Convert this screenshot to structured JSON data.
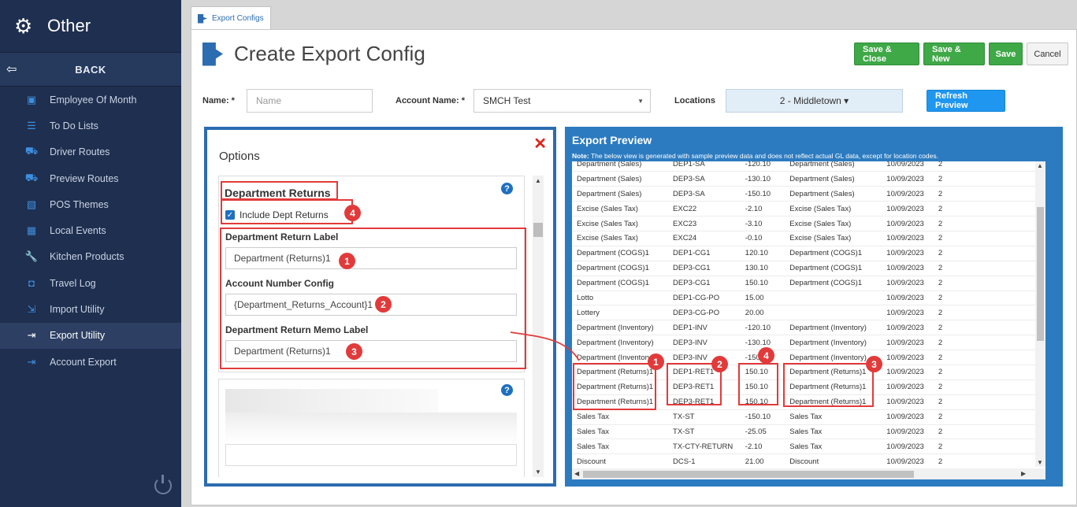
{
  "sidebar": {
    "title": "Other",
    "back_label": "BACK",
    "items": [
      {
        "label": "Employee Of Month",
        "icon": "gift-icon"
      },
      {
        "label": "To Do Lists",
        "icon": "list-icon"
      },
      {
        "label": "Driver Routes",
        "icon": "truck-icon"
      },
      {
        "label": "Preview Routes",
        "icon": "truck-icon"
      },
      {
        "label": "POS Themes",
        "icon": "image-icon"
      },
      {
        "label": "Local Events",
        "icon": "calendar-icon"
      },
      {
        "label": "Kitchen Products",
        "icon": "wrench-icon"
      },
      {
        "label": "Travel Log",
        "icon": "bus-icon"
      },
      {
        "label": "Import Utility",
        "icon": "import-icon"
      },
      {
        "label": "Export Utility",
        "icon": "export-icon",
        "active": true
      },
      {
        "label": "Account Export",
        "icon": "export-icon"
      }
    ]
  },
  "tab": {
    "label": "Export Configs"
  },
  "page": {
    "title": "Create Export Config"
  },
  "toolbar": {
    "save_close": "Save & Close",
    "save_new": "Save & New",
    "save": "Save",
    "cancel": "Cancel",
    "refresh": "Refresh Preview"
  },
  "form": {
    "name_label": "Name: *",
    "name_placeholder": "Name",
    "account_label": "Account Name: *",
    "account_value": "SMCH Test",
    "locations_label": "Locations",
    "locations_value": "2 - Middletown ▾"
  },
  "options": {
    "title": "Options",
    "card_title": "Department Returns",
    "checkbox_label": "Include Dept Returns",
    "return_label_title": "Department Return Label",
    "return_label_value": "Department (Returns)1",
    "account_config_title": "Account Number Config",
    "account_config_value": "{Department_Returns_Account}1",
    "memo_label_title": "Department Return Memo Label",
    "memo_label_value": "Department (Returns)1"
  },
  "preview": {
    "title": "Export Preview",
    "note_bold": "Note:",
    "note_text": " The below view is generated with sample preview data and does not reflect actual GL data, except for location codes.",
    "rows": [
      [
        "Department (Sales)",
        "DEP1-SA",
        "-120.10",
        "Department (Sales)",
        "10/09/2023",
        "2"
      ],
      [
        "Department (Sales)",
        "DEP3-SA",
        "-130.10",
        "Department (Sales)",
        "10/09/2023",
        "2"
      ],
      [
        "Department (Sales)",
        "DEP3-SA",
        "-150.10",
        "Department (Sales)",
        "10/09/2023",
        "2"
      ],
      [
        "Excise (Sales Tax)",
        "EXC22",
        "-2.10",
        "Excise (Sales Tax)",
        "10/09/2023",
        "2"
      ],
      [
        "Excise (Sales Tax)",
        "EXC23",
        "-3.10",
        "Excise (Sales Tax)",
        "10/09/2023",
        "2"
      ],
      [
        "Excise (Sales Tax)",
        "EXC24",
        "-0.10",
        "Excise (Sales Tax)",
        "10/09/2023",
        "2"
      ],
      [
        "Department (COGS)1",
        "DEP1-CG1",
        "120.10",
        "Department (COGS)1",
        "10/09/2023",
        "2"
      ],
      [
        "Department (COGS)1",
        "DEP3-CG1",
        "130.10",
        "Department (COGS)1",
        "10/09/2023",
        "2"
      ],
      [
        "Department (COGS)1",
        "DEP3-CG1",
        "150.10",
        "Department (COGS)1",
        "10/09/2023",
        "2"
      ],
      [
        "Lotto",
        "DEP1-CG-PO",
        "15.00",
        "",
        "10/09/2023",
        "2"
      ],
      [
        "Lottery",
        "DEP3-CG-PO",
        "20.00",
        "",
        "10/09/2023",
        "2"
      ],
      [
        "Department (Inventory)",
        "DEP1-INV",
        "-120.10",
        "Department (Inventory)",
        "10/09/2023",
        "2"
      ],
      [
        "Department (Inventory)",
        "DEP3-INV",
        "-130.10",
        "Department (Inventory)",
        "10/09/2023",
        "2"
      ],
      [
        "Department (Inventory)",
        "DEP3-INV",
        "-150.10",
        "Department (Inventory)",
        "10/09/2023",
        "2"
      ],
      [
        "Department (Returns)1",
        "DEP1-RET1",
        "150.10",
        "Department (Returns)1",
        "10/09/2023",
        "2"
      ],
      [
        "Department (Returns)1",
        "DEP3-RET1",
        "150.10",
        "Department (Returns)1",
        "10/09/2023",
        "2"
      ],
      [
        "Department (Returns)1",
        "DEP3-RET1",
        "150.10",
        "Department (Returns)1",
        "10/09/2023",
        "2"
      ],
      [
        "Sales Tax",
        "TX-ST",
        "-150.10",
        "Sales Tax",
        "10/09/2023",
        "2"
      ],
      [
        "Sales Tax",
        "TX-ST",
        "-25.05",
        "Sales Tax",
        "10/09/2023",
        "2"
      ],
      [
        "Sales Tax",
        "TX-CTY-RETURN",
        "-2.10",
        "Sales Tax",
        "10/09/2023",
        "2"
      ],
      [
        "Discount",
        "DCS-1",
        "21.00",
        "Discount",
        "10/09/2023",
        "2"
      ]
    ]
  },
  "annotations": {
    "one": "1",
    "two": "2",
    "three": "3",
    "four": "4",
    "color": "#e23a3a"
  },
  "colors": {
    "sidebar_bg": "#1f2f4f",
    "accent_blue": "#2c6cb0",
    "green": "#3fa847",
    "refresh_blue": "#1f96ef"
  }
}
